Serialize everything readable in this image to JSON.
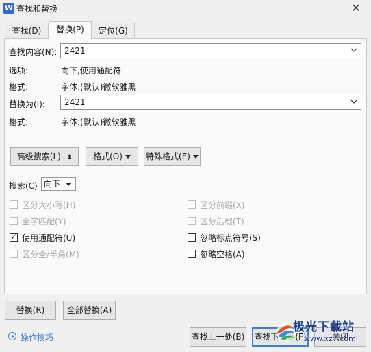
{
  "window": {
    "title": "查找和替换",
    "icon_letter": "W"
  },
  "tabs": [
    {
      "label": "查找(D)"
    },
    {
      "label": "替换(P)",
      "active": true
    },
    {
      "label": "定位(G)"
    }
  ],
  "find": {
    "label": "查找内容(N):",
    "value": "2421"
  },
  "options": {
    "label": "选项:",
    "value": "向下,使用通配符"
  },
  "find_format": {
    "label": "格式:",
    "value": "字体:(默认)微软雅黑"
  },
  "replace": {
    "label": "替换为(I):",
    "value": "2421"
  },
  "replace_format": {
    "label": "格式:",
    "value": "字体:(默认)微软雅黑"
  },
  "buttons": {
    "advanced": "高级搜索(L)",
    "format": "格式(O)",
    "special": "特殊格式(E)",
    "replace": "替换(R)",
    "replace_all": "全部替换(A)",
    "find_prev": "查找上一处(B)",
    "find_next": "查找下一处(F)",
    "close": "关闭"
  },
  "search": {
    "label": "搜索(C)",
    "value": "向下"
  },
  "checkboxes_left": [
    {
      "label": "区分大小写(H)",
      "checked": false,
      "enabled": false
    },
    {
      "label": "全字匹配(Y)",
      "checked": false,
      "enabled": false
    },
    {
      "label": "使用通配符(U)",
      "checked": true,
      "enabled": true
    },
    {
      "label": "区分全/半角(M)",
      "checked": false,
      "enabled": false
    }
  ],
  "checkboxes_right": [
    {
      "label": "区分前缀(X)",
      "checked": false,
      "enabled": false
    },
    {
      "label": "区分后缀(T)",
      "checked": false,
      "enabled": false
    },
    {
      "label": "忽略标点符号(S)",
      "checked": false,
      "enabled": true
    },
    {
      "label": "忽略空格(A)",
      "checked": false,
      "enabled": true
    }
  ],
  "help_link": "操作技巧",
  "watermark": {
    "line1": "极光下载站",
    "line2": "www.xz7.com"
  }
}
